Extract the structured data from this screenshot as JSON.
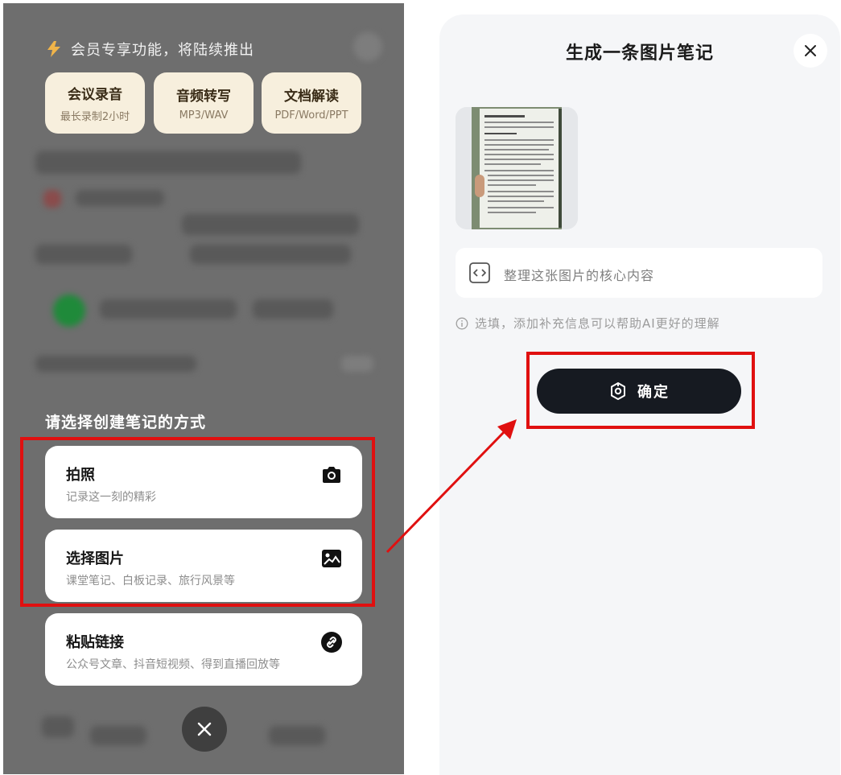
{
  "left_panel": {
    "vip_banner": "会员专享功能，将陆续推出",
    "features": [
      {
        "title": "会议录音",
        "subtitle": "最长录制2小时"
      },
      {
        "title": "音频转写",
        "subtitle": "MP3/WAV"
      },
      {
        "title": "文档解读",
        "subtitle": "PDF/Word/PPT"
      }
    ],
    "choose_title": "请选择创建笔记的方式",
    "options": [
      {
        "title": "拍照",
        "subtitle": "记录这一刻的精彩",
        "icon": "camera-icon"
      },
      {
        "title": "选择图片",
        "subtitle": "课堂笔记、白板记录、旅行风景等",
        "icon": "image-icon"
      },
      {
        "title": "粘贴链接",
        "subtitle": "公众号文章、抖音短视频、得到直播回放等",
        "icon": "link-icon"
      }
    ],
    "close_icon": "close-icon"
  },
  "right_panel": {
    "title": "生成一条图片笔记",
    "close_icon": "close-icon",
    "input_placeholder": "整理这张图片的核心内容",
    "hint": "选填，添加补充信息可以帮助AI更好的理解",
    "confirm_label": "确定"
  },
  "colors": {
    "highlight_red": "#e01010",
    "button_dark": "#161a21",
    "feature_card": "#f7efdd"
  }
}
